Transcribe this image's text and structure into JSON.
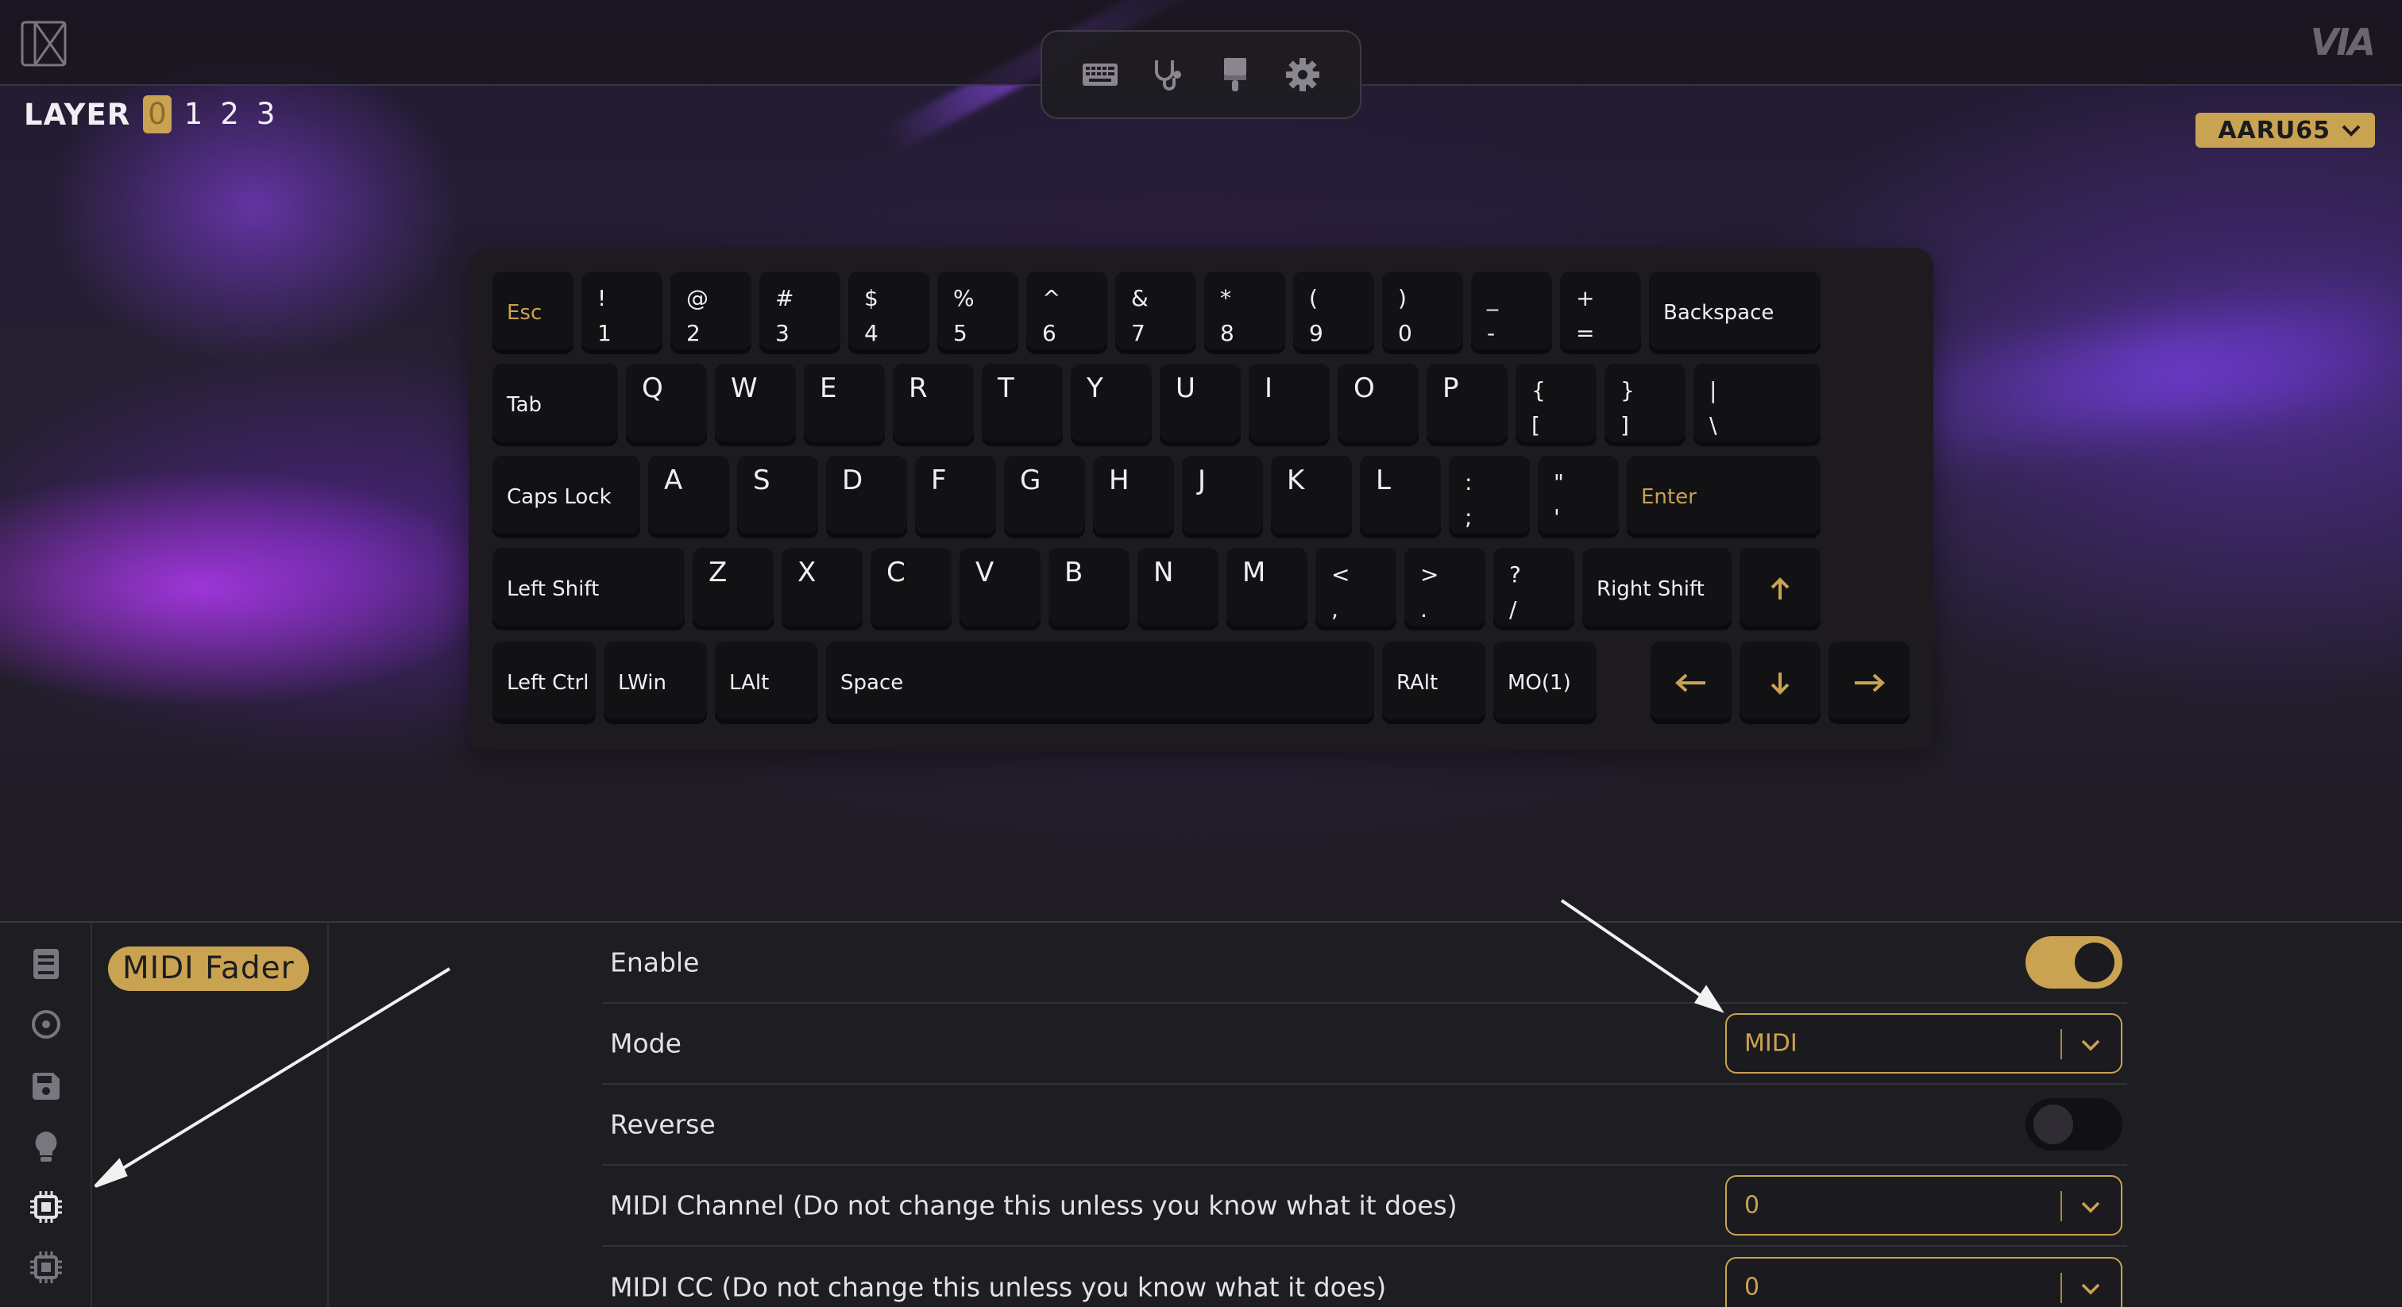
{
  "colors": {
    "accent": "#c9a351",
    "background": "#1e1d21",
    "key": "#121114",
    "glow": "#8f4bff"
  },
  "app": {
    "brand": "VIA"
  },
  "nav": {
    "items": [
      {
        "icon": "keyboard-icon",
        "label": "Configure"
      },
      {
        "icon": "stethoscope-icon",
        "label": "Key Tester"
      },
      {
        "icon": "paintbrush-icon",
        "label": "Design"
      },
      {
        "icon": "gear-icon",
        "label": "Settings"
      }
    ]
  },
  "layers": {
    "label": "LAYER",
    "items": [
      "0",
      "1",
      "2",
      "3"
    ],
    "active": "0"
  },
  "keyboard_select": {
    "value": "AARU65"
  },
  "keys": {
    "esc": "Esc",
    "backspace": "Backspace",
    "tab": "Tab",
    "caps": "Caps Lock",
    "enter": "Enter",
    "lshift": "Left Shift",
    "rshift": "Right Shift",
    "lctrl": "Left Ctrl",
    "lwin": "LWin",
    "lalt": "LAlt",
    "space": "Space",
    "ralt": "RAlt",
    "mo1": "MO(1)",
    "n1": "!\n1",
    "n2": "@\n2",
    "n3": "#\n3",
    "n4": "$\n4",
    "n5": "%\n5",
    "n6": "^\n6",
    "n7": "&\n7",
    "n8": "*\n8",
    "n9": "(\n9",
    "n0": ")\n0",
    "minus": "_\n-",
    "equal": "+\n=",
    "q": "Q",
    "w": "W",
    "e": "E",
    "r": "R",
    "t": "T",
    "y": "Y",
    "u": "U",
    "i": "I",
    "o": "O",
    "p": "P",
    "lbracket": "{\n[",
    "rbracket": "}\n]",
    "bslash": "|\n\\",
    "a": "A",
    "s": "S",
    "d": "D",
    "f": "F",
    "g": "G",
    "h": "H",
    "j": "J",
    "k": "K",
    "l": "L",
    "semicolon": ":\n;",
    "quote": "\"\n'",
    "z": "Z",
    "x": "X",
    "c": "C",
    "v": "V",
    "b": "B",
    "n": "N",
    "m": "M",
    "comma": "<\n,",
    "period": ">\n.",
    "slash": "?\n/",
    "up": "↑",
    "left": "←",
    "down": "↓",
    "right": "→"
  },
  "sidebar": {
    "icons": [
      "document-icon",
      "circle-dot-icon",
      "floppy-disk-icon",
      "lightbulb-icon",
      "chip-icon",
      "chip-icon"
    ]
  },
  "menu": {
    "active_item": "MIDI Fader"
  },
  "settings": {
    "enable": {
      "label": "Enable",
      "on": true
    },
    "mode": {
      "label": "Mode",
      "value": "MIDI"
    },
    "reverse": {
      "label": "Reverse",
      "on": false
    },
    "midi_channel": {
      "label": "MIDI Channel (Do not change this unless you know what it does)",
      "value": "0"
    },
    "midi_cc": {
      "label": "MIDI CC (Do not change this unless you know what it does)",
      "value": "0"
    }
  }
}
